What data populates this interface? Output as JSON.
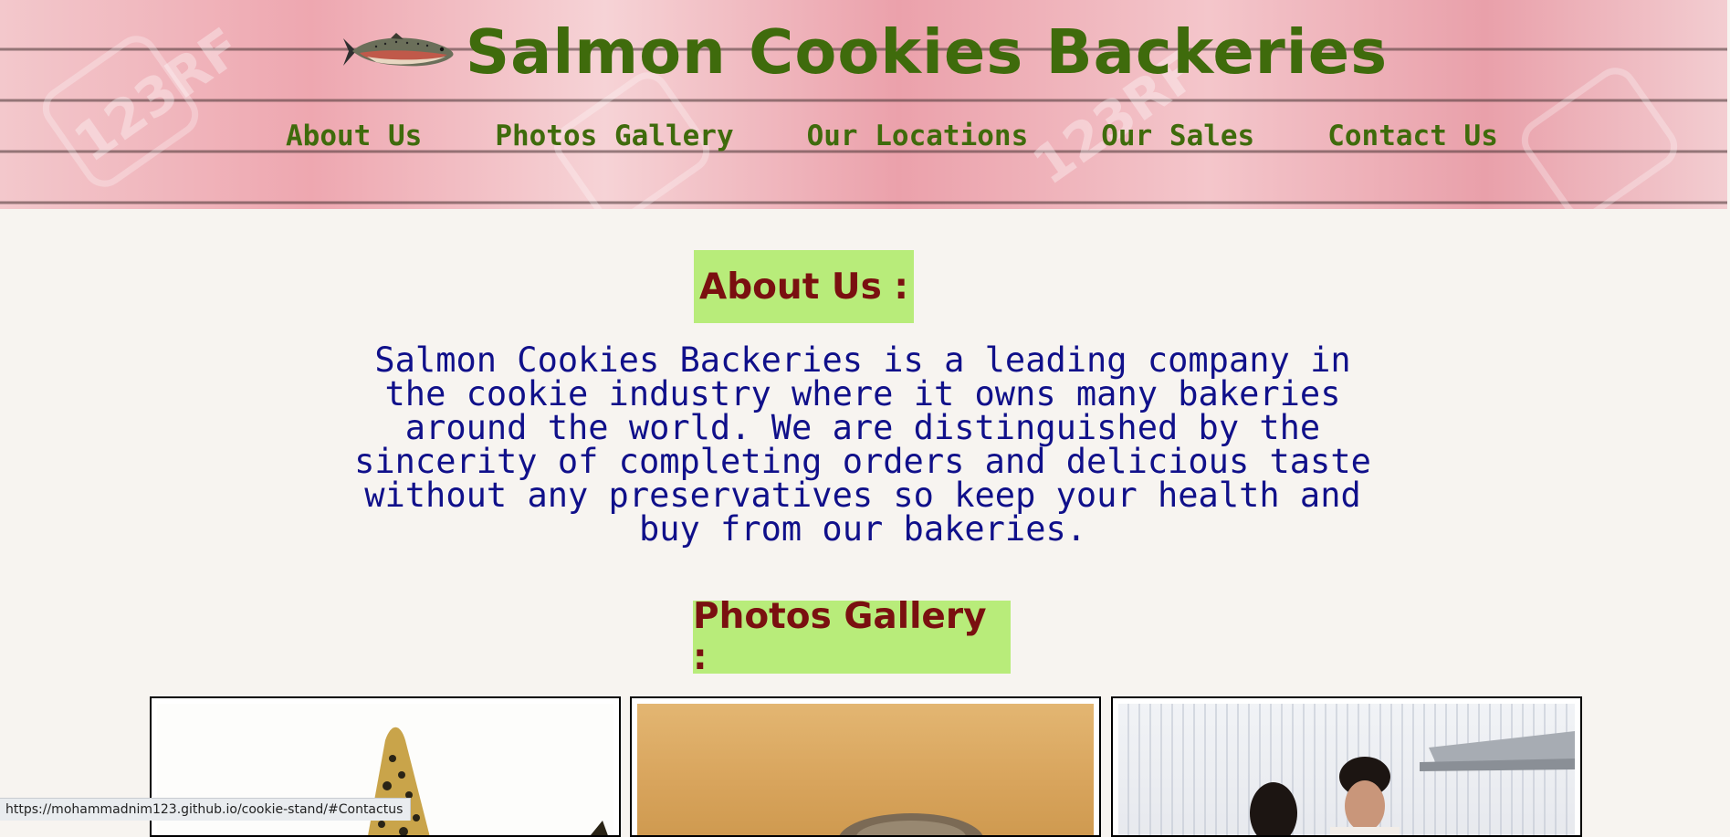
{
  "header": {
    "title": "Salmon Cookies Backeries",
    "logo_icon": "salmon-fish-icon",
    "watermark_text": "123RF",
    "nav": [
      {
        "label": "About Us"
      },
      {
        "label": "Photos Gallery"
      },
      {
        "label": "Our Locations"
      },
      {
        "label": "Our Sales"
      },
      {
        "label": "Contact Us"
      }
    ]
  },
  "about": {
    "heading": "About Us :",
    "text": "Salmon Cookies Backeries is a leading company in the cookie industry where it owns many bakeries around the world. We are distinguished by the sincerity of completing orders and delicious taste without any preservatives so keep your health and buy from our bakeries."
  },
  "gallery": {
    "heading": "Photos Gallery :",
    "photos": [
      "salmon-photo",
      "cookie-baking-photo",
      "bakery-staff-photo"
    ]
  },
  "status_bar": {
    "url": "https://mohammadnim123.github.io/cookie-stand/#Contactus"
  },
  "colors": {
    "title_green": "#3f6b0c",
    "heading_bg": "#b8ec7a",
    "heading_text": "#7a1010",
    "body_text": "#10108a",
    "page_bg": "#f7f4f0"
  }
}
